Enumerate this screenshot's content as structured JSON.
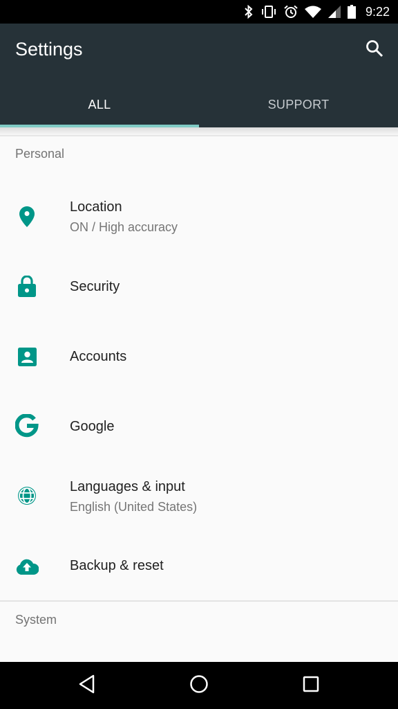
{
  "status_bar": {
    "time": "9:22",
    "icons": [
      "bluetooth-icon",
      "vibrate-icon",
      "alarm-icon",
      "wifi-icon",
      "cell-signal-icon",
      "battery-icon"
    ]
  },
  "app_bar": {
    "title": "Settings",
    "search_icon": "search-icon"
  },
  "tabs": [
    {
      "label": "ALL",
      "active": true
    },
    {
      "label": "SUPPORT",
      "active": false
    }
  ],
  "colors": {
    "app_bar": "#263238",
    "tab_indicator": "#80cbc4",
    "icon_accent": "#009688"
  },
  "sections": [
    {
      "header": "Personal",
      "items": [
        {
          "icon": "location-icon",
          "title": "Location",
          "summary": "ON / High accuracy"
        },
        {
          "icon": "lock-icon",
          "title": "Security"
        },
        {
          "icon": "account-box-icon",
          "title": "Accounts"
        },
        {
          "icon": "google-icon",
          "title": "Google"
        },
        {
          "icon": "globe-icon",
          "title": "Languages & input",
          "summary": "English (United States)"
        },
        {
          "icon": "cloud-upload-icon",
          "title": "Backup & reset"
        }
      ]
    },
    {
      "header": "System",
      "items": []
    }
  ],
  "nav_bar": {
    "buttons": [
      "back-icon",
      "home-icon",
      "recents-icon"
    ]
  }
}
